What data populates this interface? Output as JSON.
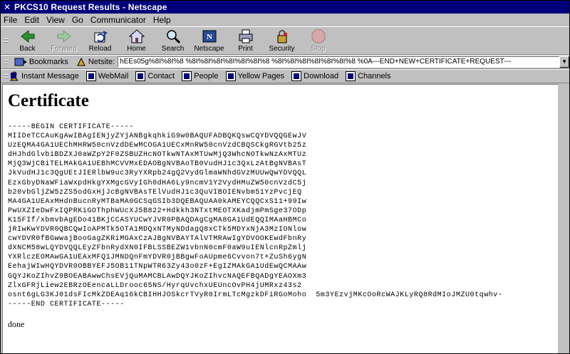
{
  "window": {
    "title": "PKCS10 Request Results - Netscape"
  },
  "menu": [
    "File",
    "Edit",
    "View",
    "Go",
    "Communicator",
    "Help"
  ],
  "toolbar": {
    "buttons": [
      {
        "label": "Back",
        "enabled": true
      },
      {
        "label": "Forward",
        "enabled": false
      },
      {
        "label": "Reload",
        "enabled": true
      },
      {
        "label": "Home",
        "enabled": true
      },
      {
        "label": "Search",
        "enabled": true
      },
      {
        "label": "Netscape",
        "enabled": true
      },
      {
        "label": "Print",
        "enabled": true
      },
      {
        "label": "Security",
        "enabled": true
      },
      {
        "label": "Stop",
        "enabled": false
      }
    ]
  },
  "location_bar": {
    "bookmarks_label": "Bookmarks",
    "location_label": "Netsite:",
    "url": "hEEs05g%8I%8I%8 %8I%8I%8I%8I%8I%8I%8 %8I%8I%8I%8I%8I%8I%8 %0A---END+NEW+CERTIFICATE+REQUEST---"
  },
  "personal_toolbar": {
    "items": [
      "Instant Message",
      "WebMail",
      "Contact",
      "People",
      "Yellow Pages",
      "Download",
      "Channels"
    ]
  },
  "page": {
    "heading": "Certificate",
    "certificate_lines": [
      "-----BEGIN CERTIFICATE-----",
      "MIIDeTCCAuKgAwIBAgIENjyZYjANBgkqhkiG9w0BAQUFADBQKQswCQYDVQQGEwJV",
      "UzEQMA4GA1UEChMHRW50cnVzdDEwMCOGA1UECxMnRW50cnVzdCBQSCkgRGVtb25z",
      "dHJhdGlvbiBDZXJ0aWZpY2F0ZSBUZHcNOTkwNTAxMTUwMjQ3WhcNOTkwNzAxMTUz",
      "MjQ3WjCBiTELMAkGA1UEBhMCVVMxEDAOBgNVBAoTB0VudHJ1c3QxLzAtBgNVBAsT",
      "JkVudHJ1c3QgUEtJIERlbW9uc3RyYXRpb24gQ2VydGlmaWNhdGVzMUUwQwYDVQQL",
      "EzxGbyDNaWFiaWxpdHkgYXMgcGVyIGh0dHA6Ly9ncmV1Y2VydHMuZW50cnVzdC5j",
      "b20vbGljZW5zZS5odGxHjJcBgNVBAsTElVudHJ1c3QuVIBOIENvbm51YzPvcjEQ",
      "MA4GA1UEAxMHdnBucnRyMTBaMA0GCSqGSIb3DQEBAQUAA0kAMEYCQQCxS11+99Iw",
      "PwUXZIeDwFxIQPRKiGOThphWUcXJ5B822+Hdkkh3NTxtMEOTXKadjmPmSge37ODp",
      "K15FIf/xbmvbAgEDo41BKjCCASYUCwYJVR0PBAQDAgCgMA8GA1UdEQQIMAaHBMCo",
      "jRIwKwYDVR0QBCQwIoAPMTk5OTA1MDQxNTMyNDdagQ8xCTk5MDYxNjA3MzIONlow",
      "cwYDVR0fBGwwajBooGagZKRiMGAxCzAJBgNVBAYTAlVTMRAwIgYDVOOKEwdFbnRy",
      "dXNCM58wLQYDVQQLEyZFbnRydXN0IFBLSSBEZW1vbnN0cmF0aW9uIENlcnRpZmlj",
      "YXRlczEOMAwGA1UEAxMFQ1JMNDQnFmYDVR0jBBgwFoAUpme6Cvvon7t+ZuSh6ygN",
      "EehajWIwHQYDVR0OBBYEFJ5OB11TNpWTR63Zy43o0zF+EgIZMAkGA1UdEwQCMAAw",
      "GQYJKoZIhvZ9BOEABAwwChsEVjQuMAMCBLAwDQYJKoZIhvcNAQEFBQADgYEAOXm3",
      "ZlxGFRjLiew2EBRzOEencaLLDrooc65NS/HyrqUvchxUEUncOvPH4jUMRxz43s2",
      "osnt6gLG3KJ01dsFIcMkZDEAq16kCBIHHJOSkcrTVyR0IrmLTcMgzkDFiRGoMoho  5m3YEzvjMKcOoRcWAJKLyRQ8RdMIoJMZU0tqwhv-",
      "-----END CERTIFICATE-----"
    ],
    "status_text": "done"
  }
}
